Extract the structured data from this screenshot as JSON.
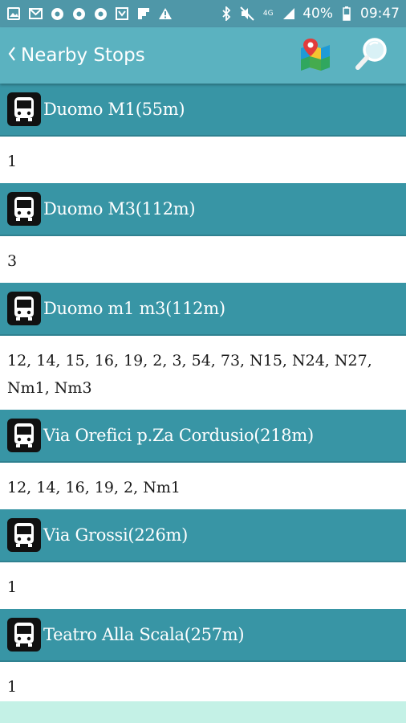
{
  "status_bar": {
    "battery": "40%",
    "time": "09:47",
    "network": "4G"
  },
  "app_bar": {
    "title": "Nearby Stops",
    "back_icon": "chevron-left-icon",
    "map_icon": "map-icon",
    "search_icon": "search-icon"
  },
  "stops": [
    {
      "name": "Duomo M1(55m)",
      "lines": "1"
    },
    {
      "name": "Duomo M3(112m)",
      "lines": "3"
    },
    {
      "name": "Duomo m1 m3(112m)",
      "lines": "12, 14, 15, 16, 19, 2, 3, 54, 73, N15, N24, N27, Nm1, Nm3"
    },
    {
      "name": "Via Orefici p.Za Cordusio(218m)",
      "lines": "12, 14, 16, 19, 2, Nm1"
    },
    {
      "name": "Via Grossi(226m)",
      "lines": "1"
    },
    {
      "name": "Teatro Alla Scala(257m)",
      "lines": "1"
    }
  ],
  "colors": {
    "status_bar": "#4f97a8",
    "app_bar": "#5bb2c0",
    "stop_header": "#3895a5",
    "bottom_strip": "#c4f1e6"
  }
}
